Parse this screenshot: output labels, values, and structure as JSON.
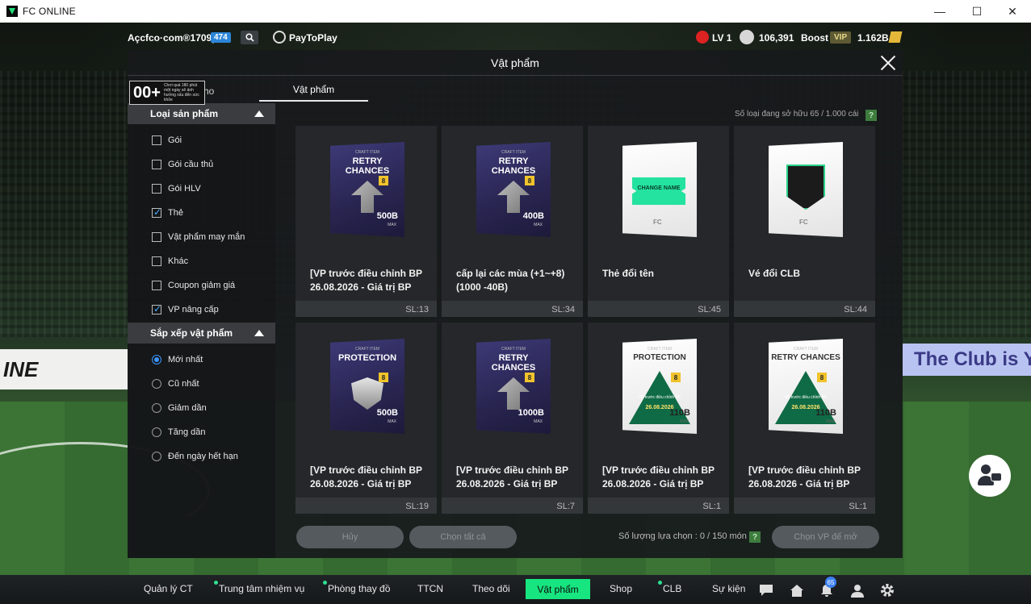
{
  "window": {
    "title": "FC ONLINE",
    "controls": [
      "—",
      "☐",
      "✕"
    ]
  },
  "topbar": {
    "account": "Açcfco·com®1709p",
    "account_badge": "474",
    "paytoplay": "PayToPlay",
    "level": "LV 1",
    "coins": "106,391",
    "boost": "Boost",
    "vip": "VIP",
    "bp": "1.162B"
  },
  "modal": {
    "title": "Vật phẩm",
    "age_rating": "00+",
    "age_note": "Chơi quá 180 phút một ngày sẽ ảnh hưởng xấu đến sức khỏe",
    "tabs": {
      "kho": "Kho",
      "vat_pham": "Vật phẩm"
    },
    "owned_label": "Số loại đang sở hữu 65 / 1.000 cái",
    "help_glyph": "?"
  },
  "sidebar": {
    "product_type_title": "Loại sản phẩm",
    "product_types": [
      {
        "label": "Gói",
        "checked": false
      },
      {
        "label": "Gói cầu thủ",
        "checked": false
      },
      {
        "label": "Gói HLV",
        "checked": false
      },
      {
        "label": "Thẻ",
        "checked": true
      },
      {
        "label": "Vật phẩm may mắn",
        "checked": false
      },
      {
        "label": "Khác",
        "checked": false
      },
      {
        "label": "Coupon giảm giá",
        "checked": false
      },
      {
        "label": "VP nâng cấp",
        "checked": true
      }
    ],
    "sort_title": "Sắp xếp vật phẩm",
    "sort_options": [
      {
        "label": "Mới nhất",
        "selected": true
      },
      {
        "label": "Cũ nhất",
        "selected": false
      },
      {
        "label": "Giảm dần",
        "selected": false
      },
      {
        "label": "Tăng dần",
        "selected": false
      },
      {
        "label": "Đến ngày hết hạn",
        "selected": false
      }
    ]
  },
  "items": [
    {
      "name": "[VP trước điều chỉnh BP 26.08.2026 - Giá trị BP",
      "qty": "SL:13",
      "card": {
        "style": "dark",
        "craft": "CRAFT ITEM",
        "title": "RETRY CHANCES",
        "level": "8",
        "amount": "500B",
        "max": "MAX",
        "art": "arrow"
      }
    },
    {
      "name": "cấp lại các mùa (+1~+8) (1000 -40B)",
      "qty": "SL:34",
      "card": {
        "style": "dark",
        "craft": "CRAFT ITEM",
        "title": "RETRY CHANCES",
        "level": "8",
        "amount": "400B",
        "max": "MAX",
        "art": "arrow"
      }
    },
    {
      "name": "Thẻ đổi tên",
      "qty": "SL:45",
      "card": {
        "style": "light",
        "art": "ticket",
        "ticket_text": "CHANGE NAME",
        "mark": "FC"
      }
    },
    {
      "name": "Vé đổi CLB",
      "qty": "SL:44",
      "card": {
        "style": "light",
        "art": "club",
        "mark": "FC"
      }
    },
    {
      "name": "[VP trước điều chỉnh BP 26.08.2026 - Giá trị BP",
      "qty": "SL:19",
      "card": {
        "style": "dark",
        "craft": "CRAFT ITEM",
        "title": "PROTECTION",
        "level": "8",
        "amount": "500B",
        "max": "MAX",
        "art": "shield"
      }
    },
    {
      "name": "[VP trước điều chỉnh BP 26.08.2026 - Giá trị BP",
      "qty": "SL:7",
      "card": {
        "style": "dark",
        "craft": "CRAFT ITEM",
        "title": "RETRY CHANCES",
        "level": "8",
        "amount": "1000B",
        "max": "MAX",
        "art": "arrow"
      }
    },
    {
      "name": "[VP trước điều chỉnh BP 26.08.2026 - Giá trị BP",
      "qty": "SL:1",
      "card": {
        "style": "light",
        "craft": "CRAFT ITEM",
        "title": "PROTECTION",
        "level": "8",
        "amount": "110B",
        "max": "MAX",
        "art": "warn",
        "warn_text": "VP trước điều chỉnh BP",
        "warn_date": "26.08.2026"
      }
    },
    {
      "name": "[VP trước điều chỉnh BP 26.08.2026 - Giá trị BP",
      "qty": "SL:1",
      "card": {
        "style": "light",
        "craft": "CRAFT ITEM",
        "title": "RETRY CHANCES",
        "level": "8",
        "amount": "110B",
        "max": "MAX",
        "art": "warn",
        "warn_text": "VP trước điều chỉnh BP",
        "warn_date": "26.08.2026"
      }
    }
  ],
  "actions": {
    "cancel": "Hủy",
    "select_all": "Chọn tất cả",
    "selection_count": "Số lượng lựa chọn : 0 / 150 món",
    "open_selected": "Chọn VP để mở"
  },
  "scene": {
    "left_banner": "INE",
    "right_banner": "The Club is Y"
  },
  "bottom_nav": {
    "items": [
      "Quản lý CT",
      "Trung tâm nhiệm vụ",
      "Phòng thay đồ",
      "TTCN",
      "Theo dõi",
      "Vật phẩm",
      "Shop",
      "CLB",
      "Sự kiện"
    ],
    "notification_count": "65"
  },
  "colors": {
    "accent_green": "#17e57f",
    "vip_gold": "#e8d98a",
    "check_blue": "#3c95ff"
  }
}
